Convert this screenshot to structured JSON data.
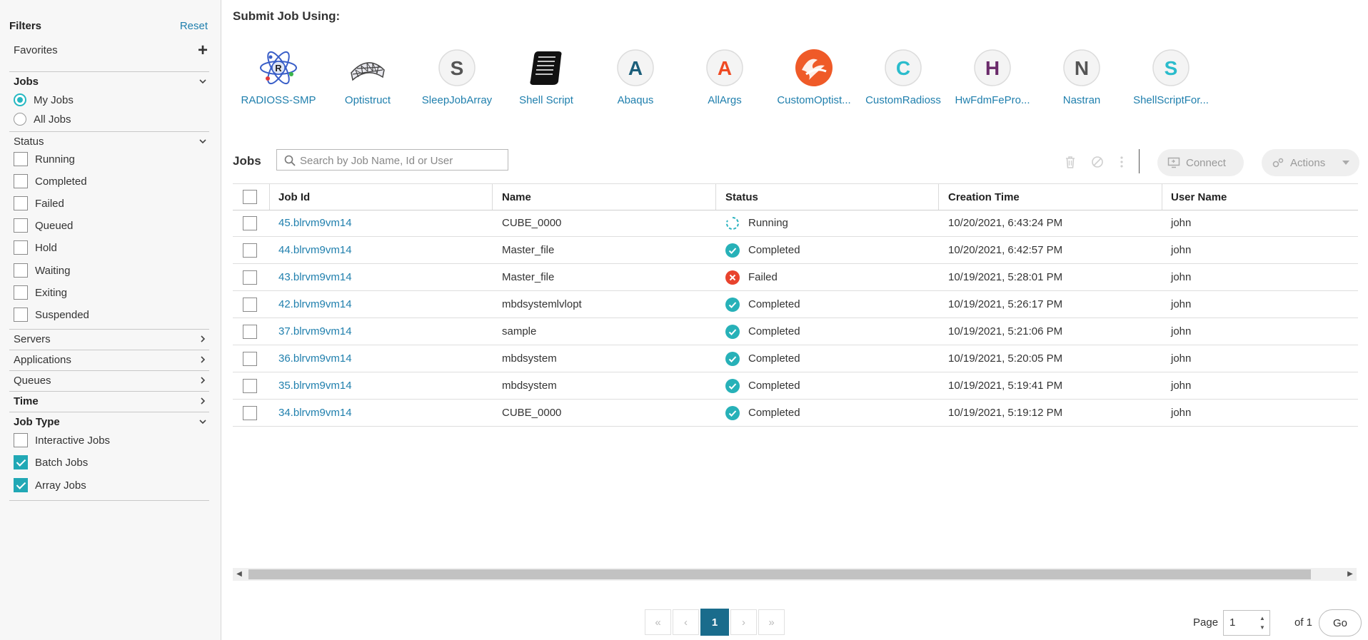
{
  "filters": {
    "title": "Filters",
    "reset": "Reset",
    "favorites": "Favorites",
    "jobs": {
      "title": "Jobs",
      "options": [
        "My Jobs",
        "All Jobs"
      ],
      "selected": "My Jobs"
    },
    "status": {
      "title": "Status",
      "options": [
        "Running",
        "Completed",
        "Failed",
        "Queued",
        "Hold",
        "Waiting",
        "Exiting",
        "Suspended"
      ]
    },
    "collapsed": [
      "Servers",
      "Applications",
      "Queues",
      "Time"
    ],
    "job_type": {
      "title": "Job Type",
      "options": [
        "Interactive Jobs",
        "Batch Jobs",
        "Array Jobs"
      ],
      "checked": [
        "Batch Jobs",
        "Array Jobs"
      ]
    }
  },
  "submit": {
    "title": "Submit Job Using:",
    "apps": [
      {
        "name": "RADIOSS-SMP",
        "icon": "atom-icon"
      },
      {
        "name": "Optistruct",
        "icon": "mesh-icon"
      },
      {
        "name": "SleepJobArray",
        "icon": "letter-s-icon",
        "letter": "S",
        "color": "#555555"
      },
      {
        "name": "Shell Script",
        "icon": "scroll-icon"
      },
      {
        "name": "Abaqus",
        "icon": "letter-a-icon",
        "letter": "A",
        "color": "#1b5e7a"
      },
      {
        "name": "AllArgs",
        "icon": "letter-a-icon",
        "letter": "A",
        "color": "#ef4a23"
      },
      {
        "name": "CustomOptist...",
        "icon": "custom-optistruct-icon"
      },
      {
        "name": "CustomRadioss",
        "icon": "letter-c-icon",
        "letter": "C",
        "color": "#2bbccc"
      },
      {
        "name": "HwFdmFePro...",
        "icon": "letter-h-icon",
        "letter": "H",
        "color": "#6a2a6a"
      },
      {
        "name": "Nastran",
        "icon": "letter-n-icon",
        "letter": "N",
        "color": "#555555"
      },
      {
        "name": "ShellScriptFor...",
        "icon": "letter-s-icon",
        "letter": "S",
        "color": "#2bbccc"
      }
    ]
  },
  "jobs": {
    "title": "Jobs",
    "search_placeholder": "Search by Job Name, Id or User",
    "connect": "Connect",
    "actions": "Actions",
    "columns": [
      "Job Id",
      "Name",
      "Status",
      "Creation Time",
      "User Name"
    ],
    "rows": [
      {
        "id": "45.blrvm9vm14",
        "name": "CUBE_0000",
        "status": "Running",
        "time": "10/20/2021, 6:43:24 PM",
        "user": "john"
      },
      {
        "id": "44.blrvm9vm14",
        "name": "Master_file",
        "status": "Completed",
        "time": "10/20/2021, 6:42:57 PM",
        "user": "john"
      },
      {
        "id": "43.blrvm9vm14",
        "name": "Master_file",
        "status": "Failed",
        "time": "10/19/2021, 5:28:01 PM",
        "user": "john"
      },
      {
        "id": "42.blrvm9vm14",
        "name": "mbdsystemlvlopt",
        "status": "Completed",
        "time": "10/19/2021, 5:26:17 PM",
        "user": "john"
      },
      {
        "id": "37.blrvm9vm14",
        "name": "sample",
        "status": "Completed",
        "time": "10/19/2021, 5:21:06 PM",
        "user": "john"
      },
      {
        "id": "36.blrvm9vm14",
        "name": "mbdsystem",
        "status": "Completed",
        "time": "10/19/2021, 5:20:05 PM",
        "user": "john"
      },
      {
        "id": "35.blrvm9vm14",
        "name": "mbdsystem",
        "status": "Completed",
        "time": "10/19/2021, 5:19:41 PM",
        "user": "john"
      },
      {
        "id": "34.blrvm9vm14",
        "name": "CUBE_0000",
        "status": "Completed",
        "time": "10/19/2021, 5:19:12 PM",
        "user": "john"
      }
    ],
    "status_colors": {
      "Running": "#2bb3c0",
      "Completed": "#27b1b8",
      "Failed": "#e8432d"
    }
  },
  "pagination": {
    "first": "«",
    "prev": "‹",
    "current": "1",
    "next": "›",
    "last": "»",
    "page_label": "Page",
    "page_value": "1",
    "of_label": "of 1",
    "go": "Go"
  }
}
